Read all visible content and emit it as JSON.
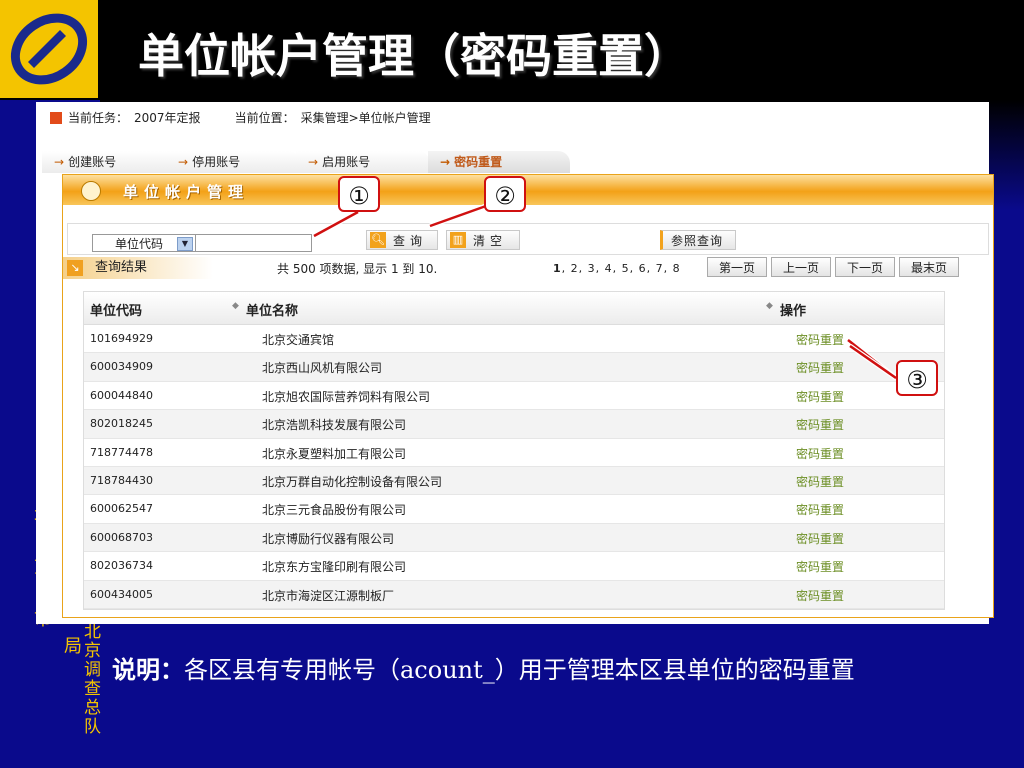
{
  "slide": {
    "title": "单位帐户管理（密码重置）",
    "side_text_1": "北京市",
    "side_text_2": "统计局",
    "side_text_3": "北京调查总队",
    "note_label": "说明：",
    "note_text": "各区县有专用帐号（acount_）用于管理本区县单位的密码重置"
  },
  "task_bar": {
    "task_label": "当前任务：",
    "task_value": "2007年定报",
    "location_label": "当前位置：",
    "location_value": "采集管理>单位帐户管理"
  },
  "tabs": [
    {
      "label": "创建账号"
    },
    {
      "label": "停用账号"
    },
    {
      "label": "启用账号"
    },
    {
      "label": "密码重置"
    }
  ],
  "module": {
    "title": "单位帐户管理"
  },
  "toolbar": {
    "select_value": "单位代码",
    "search_value": "",
    "query_label": "查询",
    "clear_label": "清空",
    "reference_label": "参照查询"
  },
  "results": {
    "label": "查询结果",
    "count_text": "共 500 项数据, 显示 1 到 10.",
    "page_current": "1",
    "page_list": ", 2, 3, 4, 5, 6, 7, 8",
    "first_label": "第一页",
    "prev_label": "上一页",
    "next_label": "下一页",
    "last_label": "最末页"
  },
  "table": {
    "columns": [
      "单位代码",
      "单位名称",
      "操作"
    ],
    "rows": [
      {
        "code": "101694929",
        "name": "北京交通宾馆",
        "op": "密码重置"
      },
      {
        "code": "600034909",
        "name": "北京西山风机有限公司",
        "op": "密码重置"
      },
      {
        "code": "600044840",
        "name": "北京旭农国际营养饲料有限公司",
        "op": "密码重置"
      },
      {
        "code": "802018245",
        "name": "北京浩凯科技发展有限公司",
        "op": "密码重置"
      },
      {
        "code": "718774478",
        "name": "北京永夏塑料加工有限公司",
        "op": "密码重置"
      },
      {
        "code": "718784430",
        "name": "北京万群自动化控制设备有限公司",
        "op": "密码重置"
      },
      {
        "code": "600062547",
        "name": "北京三元食品股份有限公司",
        "op": "密码重置"
      },
      {
        "code": "600068703",
        "name": "北京博励行仪器有限公司",
        "op": "密码重置"
      },
      {
        "code": "802036734",
        "name": "北京东方宝隆印刷有限公司",
        "op": "密码重置"
      },
      {
        "code": "600434005",
        "name": "北京市海淀区江源制板厂",
        "op": "密码重置"
      }
    ]
  },
  "markers": [
    "①",
    "②",
    "③"
  ],
  "colors": {
    "slide_background": "#0a0a8c",
    "accent_orange": "#f3a117",
    "title_yellow": "#f4c400",
    "callout_red": "#d01010",
    "link_green": "#6b8e23"
  }
}
